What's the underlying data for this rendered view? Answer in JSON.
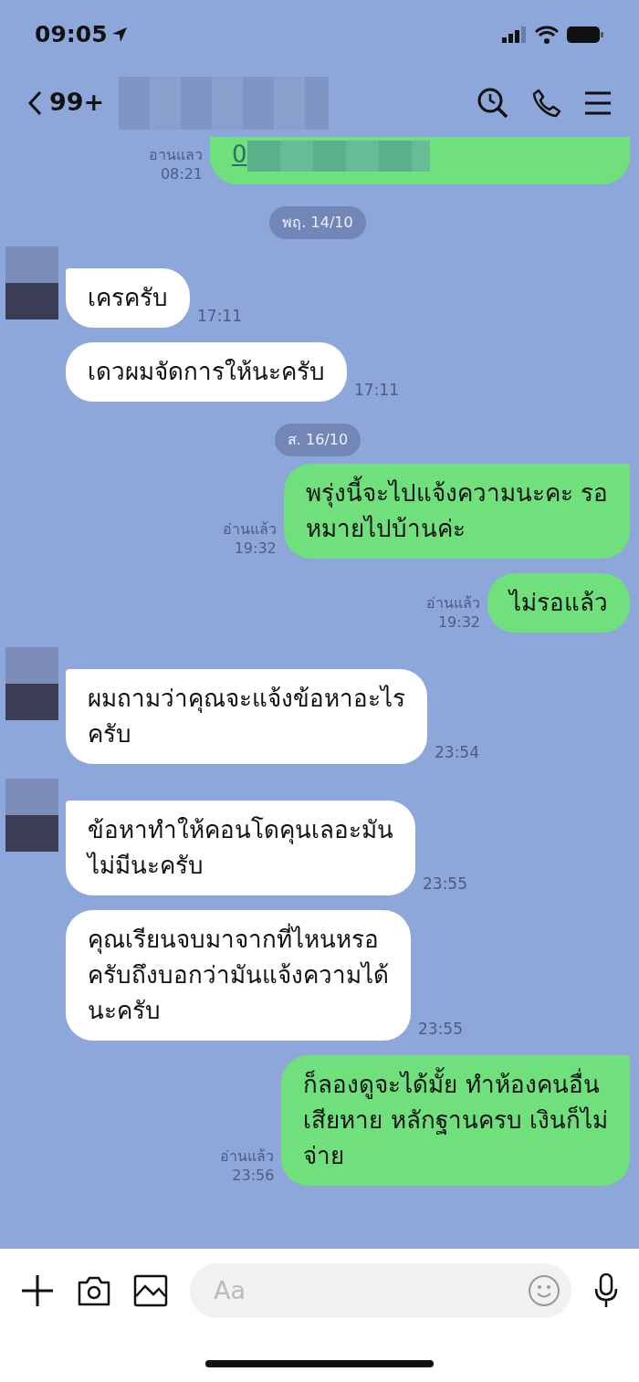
{
  "status_bar": {
    "time": "09:05"
  },
  "header": {
    "unread_count": "99+",
    "name_redacted": true
  },
  "messages": [
    {
      "kind": "out",
      "text": "0",
      "redacted": true,
      "link": true,
      "read": "อานแลว",
      "time": "08:21"
    },
    {
      "kind": "date",
      "text": "พฤ. 14/10"
    },
    {
      "kind": "in",
      "avatar": true,
      "text": "เครครับ",
      "time": "17:11"
    },
    {
      "kind": "in",
      "avatar": false,
      "text": "เดวผมจัดการให้นะครับ",
      "time": "17:11"
    },
    {
      "kind": "date",
      "text": "ส. 16/10"
    },
    {
      "kind": "out",
      "text": "พรุ่งนี้จะไปแจ้งความนะคะ รอ\nหมายไปบ้านค่ะ",
      "read": "อ่านแล้ว",
      "time": "19:32"
    },
    {
      "kind": "out",
      "text": "ไม่รอแล้ว",
      "read": "อ่านแล้ว",
      "time": "19:32"
    },
    {
      "kind": "in",
      "avatar": true,
      "text": "ผมถามว่าคุณจะแจ้งข้อหาอะไร\nครับ",
      "time": "23:54"
    },
    {
      "kind": "in",
      "avatar": true,
      "text": "ข้อหาทำให้คอนโดคุนเลอะมัน\nไม่มีนะครับ",
      "time": "23:55"
    },
    {
      "kind": "in",
      "avatar": false,
      "text": "คุณเรียนจบมาจากที่ไหนหรอ\nครับถึงบอกว่ามันแจ้งความได้\nนะครับ",
      "time": "23:55"
    },
    {
      "kind": "out",
      "text": "ก็ลองดูจะได้มั้ย ทำห้องคนอื่น\nเสียหาย หลักฐานครบ เงินก็ไม่\nจ่าย",
      "read": "อ่านแล้ว",
      "time": "23:56"
    }
  ],
  "composer": {
    "placeholder": "Aa"
  }
}
